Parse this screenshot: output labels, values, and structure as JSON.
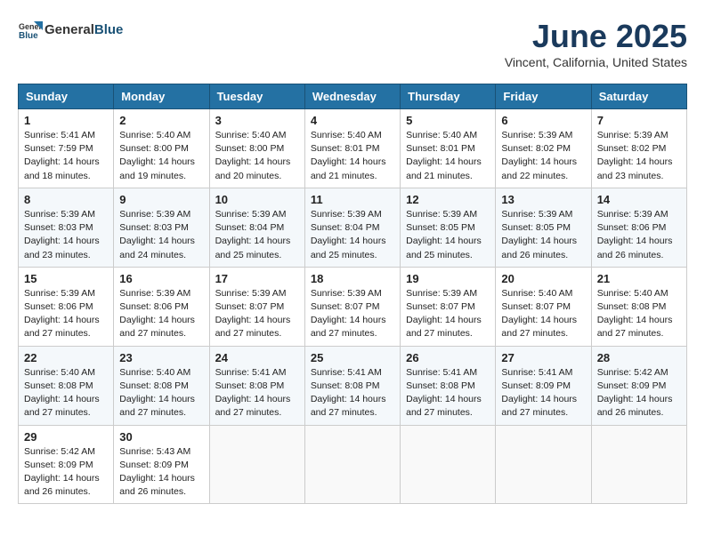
{
  "header": {
    "logo_line1": "General",
    "logo_line2": "Blue",
    "month_title": "June 2025",
    "location": "Vincent, California, United States"
  },
  "calendar": {
    "days_of_week": [
      "Sunday",
      "Monday",
      "Tuesday",
      "Wednesday",
      "Thursday",
      "Friday",
      "Saturday"
    ],
    "weeks": [
      [
        {
          "day": "1",
          "sunrise": "5:41 AM",
          "sunset": "7:59 PM",
          "daylight": "14 hours and 18 minutes."
        },
        {
          "day": "2",
          "sunrise": "5:40 AM",
          "sunset": "8:00 PM",
          "daylight": "14 hours and 19 minutes."
        },
        {
          "day": "3",
          "sunrise": "5:40 AM",
          "sunset": "8:00 PM",
          "daylight": "14 hours and 20 minutes."
        },
        {
          "day": "4",
          "sunrise": "5:40 AM",
          "sunset": "8:01 PM",
          "daylight": "14 hours and 21 minutes."
        },
        {
          "day": "5",
          "sunrise": "5:40 AM",
          "sunset": "8:01 PM",
          "daylight": "14 hours and 21 minutes."
        },
        {
          "day": "6",
          "sunrise": "5:39 AM",
          "sunset": "8:02 PM",
          "daylight": "14 hours and 22 minutes."
        },
        {
          "day": "7",
          "sunrise": "5:39 AM",
          "sunset": "8:02 PM",
          "daylight": "14 hours and 23 minutes."
        }
      ],
      [
        {
          "day": "8",
          "sunrise": "5:39 AM",
          "sunset": "8:03 PM",
          "daylight": "14 hours and 23 minutes."
        },
        {
          "day": "9",
          "sunrise": "5:39 AM",
          "sunset": "8:03 PM",
          "daylight": "14 hours and 24 minutes."
        },
        {
          "day": "10",
          "sunrise": "5:39 AM",
          "sunset": "8:04 PM",
          "daylight": "14 hours and 25 minutes."
        },
        {
          "day": "11",
          "sunrise": "5:39 AM",
          "sunset": "8:04 PM",
          "daylight": "14 hours and 25 minutes."
        },
        {
          "day": "12",
          "sunrise": "5:39 AM",
          "sunset": "8:05 PM",
          "daylight": "14 hours and 25 minutes."
        },
        {
          "day": "13",
          "sunrise": "5:39 AM",
          "sunset": "8:05 PM",
          "daylight": "14 hours and 26 minutes."
        },
        {
          "day": "14",
          "sunrise": "5:39 AM",
          "sunset": "8:06 PM",
          "daylight": "14 hours and 26 minutes."
        }
      ],
      [
        {
          "day": "15",
          "sunrise": "5:39 AM",
          "sunset": "8:06 PM",
          "daylight": "14 hours and 27 minutes."
        },
        {
          "day": "16",
          "sunrise": "5:39 AM",
          "sunset": "8:06 PM",
          "daylight": "14 hours and 27 minutes."
        },
        {
          "day": "17",
          "sunrise": "5:39 AM",
          "sunset": "8:07 PM",
          "daylight": "14 hours and 27 minutes."
        },
        {
          "day": "18",
          "sunrise": "5:39 AM",
          "sunset": "8:07 PM",
          "daylight": "14 hours and 27 minutes."
        },
        {
          "day": "19",
          "sunrise": "5:39 AM",
          "sunset": "8:07 PM",
          "daylight": "14 hours and 27 minutes."
        },
        {
          "day": "20",
          "sunrise": "5:40 AM",
          "sunset": "8:07 PM",
          "daylight": "14 hours and 27 minutes."
        },
        {
          "day": "21",
          "sunrise": "5:40 AM",
          "sunset": "8:08 PM",
          "daylight": "14 hours and 27 minutes."
        }
      ],
      [
        {
          "day": "22",
          "sunrise": "5:40 AM",
          "sunset": "8:08 PM",
          "daylight": "14 hours and 27 minutes."
        },
        {
          "day": "23",
          "sunrise": "5:40 AM",
          "sunset": "8:08 PM",
          "daylight": "14 hours and 27 minutes."
        },
        {
          "day": "24",
          "sunrise": "5:41 AM",
          "sunset": "8:08 PM",
          "daylight": "14 hours and 27 minutes."
        },
        {
          "day": "25",
          "sunrise": "5:41 AM",
          "sunset": "8:08 PM",
          "daylight": "14 hours and 27 minutes."
        },
        {
          "day": "26",
          "sunrise": "5:41 AM",
          "sunset": "8:08 PM",
          "daylight": "14 hours and 27 minutes."
        },
        {
          "day": "27",
          "sunrise": "5:41 AM",
          "sunset": "8:09 PM",
          "daylight": "14 hours and 27 minutes."
        },
        {
          "day": "28",
          "sunrise": "5:42 AM",
          "sunset": "8:09 PM",
          "daylight": "14 hours and 26 minutes."
        }
      ],
      [
        {
          "day": "29",
          "sunrise": "5:42 AM",
          "sunset": "8:09 PM",
          "daylight": "14 hours and 26 minutes."
        },
        {
          "day": "30",
          "sunrise": "5:43 AM",
          "sunset": "8:09 PM",
          "daylight": "14 hours and 26 minutes."
        },
        null,
        null,
        null,
        null,
        null
      ]
    ]
  }
}
